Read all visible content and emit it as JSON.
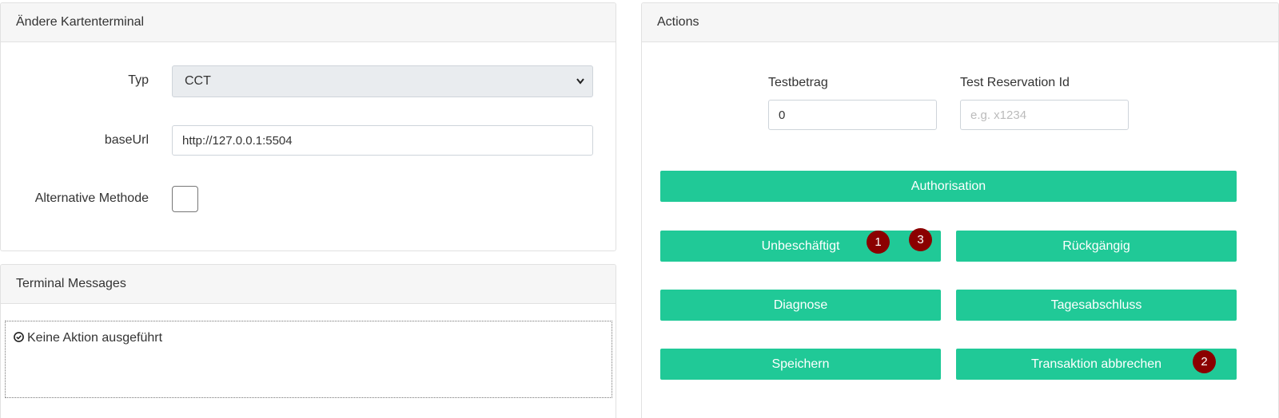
{
  "terminal_card": {
    "title": "Ändere Kartenterminal",
    "typ_label": "Typ",
    "typ_value": "CCT",
    "baseurl_label": "baseUrl",
    "baseurl_value": "http://127.0.0.1:5504",
    "alt_method_label": "Alternative Methode",
    "alt_method_checked": false
  },
  "messages_card": {
    "title": "Terminal Messages",
    "message": "Keine Aktion ausgeführt",
    "message_icon": "check-circle-icon"
  },
  "actions_card": {
    "title": "Actions",
    "amount_label": "Testbetrag",
    "amount_value": "0",
    "reservation_label": "Test Reservation Id",
    "reservation_placeholder": "e.g. x1234",
    "buttons": {
      "authorisation": "Authorisation",
      "idle": "Unbeschäftigt",
      "reverse": "Rückgängig",
      "diagnosis": "Diagnose",
      "end_of_day": "Tagesabschluss",
      "save": "Speichern",
      "abort": "Transaktion abbrechen"
    },
    "badges": [
      "1",
      "3",
      "2"
    ],
    "accent_color": "#20c997",
    "badge_color": "#8b0000"
  }
}
